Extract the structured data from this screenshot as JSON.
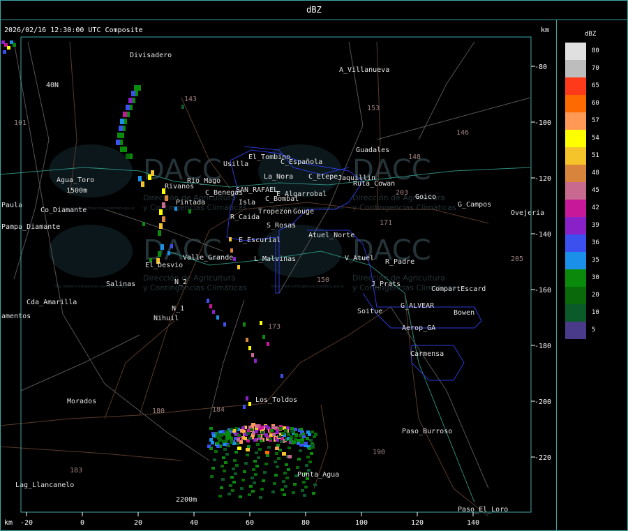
{
  "header": {
    "title": "dBZ"
  },
  "map": {
    "timestamp": "2026/02/16 12:30:00 UTC Composite",
    "unit_top": "km",
    "unit_bottom": "km",
    "x_ticks": [
      "-20",
      "0",
      "20",
      "40",
      "60",
      "80",
      "100",
      "120",
      "140"
    ],
    "y_ticks": [
      "-80",
      "-100",
      "-120",
      "-140",
      "-160",
      "-180",
      "-200",
      "-220"
    ],
    "places": [
      "Divisadero",
      "A_Villanueva",
      "40N",
      "101",
      "Guadales",
      "El_Tombino",
      "C_Española",
      "C_Etepe",
      "Jaquillin",
      "Ruta_Cowan",
      "La_Nora",
      "Usilla",
      "C_Benegas",
      "SAN_RAFAEL",
      "E_Algarrobal",
      "C_Bombal",
      "Goico",
      "G_Campos",
      "Ovejeria",
      "Agua_Toro",
      "1500m",
      "Co_Diamante",
      "Pampa_Diamante",
      "Paula",
      "Rio_Mago",
      "Rivanos",
      "Pintada",
      "Isla",
      "Tropezon",
      "Gouge",
      "S_Rosas",
      "R_Caida",
      "E_Escurial",
      "Atuel_Norte",
      "V_Atuel",
      "R_Padre",
      "El_Desvio",
      "Valle_Grande",
      "L_Malvinas",
      "N_2",
      "Salinas",
      "J_Prats",
      "CompartEscard",
      "N_1",
      "G_ALVEAR",
      "Cda_Amarilla",
      "Nihuil",
      "Soitue",
      "Bowen",
      "amentos",
      "Aerop_GA",
      "Carmensa",
      "Los_Toldos",
      "Morados",
      "Paso_Burroso",
      "Punta_Agua",
      "Lag_Llancanelo",
      "2200m",
      "Paso_El_Loro",
      "143",
      "153",
      "146",
      "148",
      "203",
      "171",
      "184",
      "180",
      "190",
      "173",
      "183",
      "150",
      "205"
    ],
    "watermark": {
      "brand": "DACC",
      "line1": "Dirección de Agricultura",
      "line2": "y Contingencias Climáticas",
      "url": "http://www.contingencias.mendoza.gov.ar"
    }
  },
  "legend": {
    "title": "dBZ",
    "items": [
      {
        "value": "80",
        "color": "#e0e0e0"
      },
      {
        "value": "70",
        "color": "#bdbdbd"
      },
      {
        "value": "65",
        "color": "#ff3a1a"
      },
      {
        "value": "60",
        "color": "#ff6a00"
      },
      {
        "value": "57",
        "color": "#ff9955"
      },
      {
        "value": "54",
        "color": "#ffff00"
      },
      {
        "value": "51",
        "color": "#f5c42a"
      },
      {
        "value": "48",
        "color": "#d8843c"
      },
      {
        "value": "45",
        "color": "#c86a90"
      },
      {
        "value": "42",
        "color": "#c8189a"
      },
      {
        "value": "39",
        "color": "#8a20c8"
      },
      {
        "value": "36",
        "color": "#3c50f0"
      },
      {
        "value": "35",
        "color": "#1a90e8"
      },
      {
        "value": "30",
        "color": "#0a8a0a"
      },
      {
        "value": "20",
        "color": "#086a08"
      },
      {
        "value": "10",
        "color": "#0a5a2a"
      },
      {
        "value": "5",
        "color": "#4a3a8a"
      }
    ]
  }
}
